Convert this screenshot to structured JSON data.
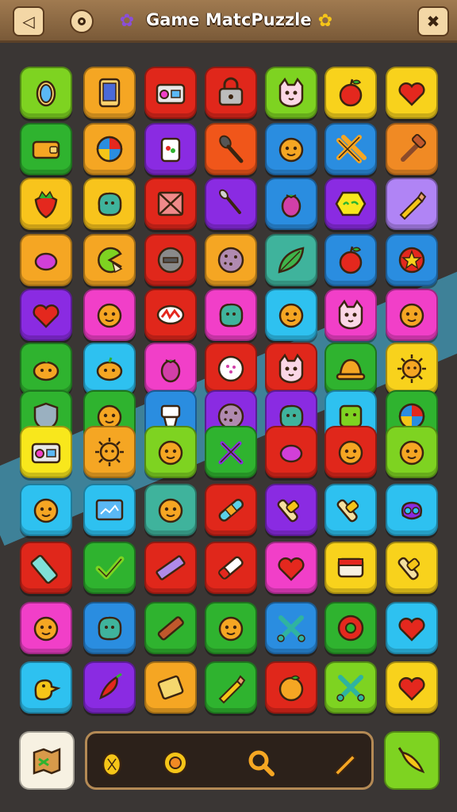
{
  "header": {
    "title": "Game MatcPuzzle",
    "back_icon": "back-arrow-icon",
    "settings_icon": "circle-icon",
    "left_deco_icon": "purple-creature-icon",
    "right_deco_icon": "yellow-creature-icon",
    "close_icon": "crossed-tools-icon",
    "bar_color": "#8b6640"
  },
  "board": {
    "background": "#3a3634",
    "stripe_color": "#3f8eaa",
    "rows": [
      [
        {
          "bg": "#7ed321",
          "icon": "mirror"
        },
        {
          "bg": "#f5a623",
          "icon": "phone"
        },
        {
          "bg": "#e0271b",
          "icon": "radio"
        },
        {
          "bg": "#e0271b",
          "icon": "lock"
        },
        {
          "bg": "#7ed321",
          "icon": "cat"
        },
        {
          "bg": "#f8d21c",
          "icon": "apple"
        },
        {
          "bg": "#f8d21c",
          "icon": "heart"
        }
      ],
      [
        {
          "bg": "#2fb32f",
          "icon": "wallet"
        },
        {
          "bg": "#f5a623",
          "icon": "ball"
        },
        {
          "bg": "#8a2be2",
          "icon": "jar"
        },
        {
          "bg": "#f0561a",
          "icon": "spatula"
        },
        {
          "bg": "#2a8de0",
          "icon": "face"
        },
        {
          "bg": "#2a8de0",
          "icon": "stripes"
        },
        {
          "bg": "#f08a24",
          "icon": "hammer"
        }
      ],
      [
        {
          "bg": "#f8c41c",
          "icon": "strawberry"
        },
        {
          "bg": "#f8c41c",
          "icon": "blob"
        },
        {
          "bg": "#e0271b",
          "icon": "crate"
        },
        {
          "bg": "#8a2be2",
          "icon": "brush"
        },
        {
          "bg": "#2a8de0",
          "icon": "plum"
        },
        {
          "bg": "#8a2be2",
          "icon": "hex"
        },
        {
          "bg": "#b084f5",
          "icon": "pencil"
        }
      ],
      [
        {
          "bg": "#f5a623",
          "icon": "egg"
        },
        {
          "bg": "#f5a623",
          "icon": "pacman"
        },
        {
          "bg": "#e0271b",
          "icon": "coin"
        },
        {
          "bg": "#f5a623",
          "icon": "cookie"
        },
        {
          "bg": "#3fb39c",
          "icon": "leaf"
        },
        {
          "bg": "#2a8de0",
          "icon": "apple"
        },
        {
          "bg": "#2a8de0",
          "icon": "star"
        }
      ],
      [
        {
          "bg": "#8a2be2",
          "icon": "heart"
        },
        {
          "bg": "#f13fc8",
          "icon": "face"
        },
        {
          "bg": "#e0271b",
          "icon": "candy"
        },
        {
          "bg": "#f13fc8",
          "icon": "blob"
        },
        {
          "bg": "#2ec1f0",
          "icon": "face"
        },
        {
          "bg": "#f13fc8",
          "icon": "cat"
        },
        {
          "bg": "#f13fc8",
          "icon": "face"
        }
      ],
      [
        {
          "bg": "#2fb32f",
          "icon": "pumpkin"
        },
        {
          "bg": "#2ec1f0",
          "icon": "pumpkin"
        },
        {
          "bg": "#f13fc8",
          "icon": "plum"
        },
        {
          "bg": "#e0271b",
          "icon": "plate"
        },
        {
          "bg": "#e0271b",
          "icon": "cat"
        },
        {
          "bg": "#2fb32f",
          "icon": "hat"
        },
        {
          "bg": "#f8d21c",
          "icon": "sun"
        }
      ],
      [
        {
          "bg": "#2fb32f",
          "icon": "shield"
        },
        {
          "bg": "#2fb32f",
          "icon": "face"
        },
        {
          "bg": "#2a8de0",
          "icon": "toilet"
        },
        {
          "bg": "#8a2be2",
          "icon": "cookie"
        },
        {
          "bg": "#8a2be2",
          "icon": "blob"
        },
        {
          "bg": "#2ec1f0",
          "icon": "cube"
        },
        {
          "bg": "#2fb32f",
          "icon": "ball"
        }
      ],
      [
        {
          "bg": "#f8e71c",
          "icon": "radio"
        },
        {
          "bg": "#f5a623",
          "icon": "sun"
        },
        {
          "bg": "#7ed321",
          "icon": "face"
        },
        {
          "bg": "#2fb32f",
          "icon": "tools"
        },
        {
          "bg": "#e0271b",
          "icon": "egg"
        },
        {
          "bg": "#e0271b",
          "icon": "face"
        },
        {
          "bg": "#7ed321",
          "icon": "face"
        }
      ],
      [
        {
          "bg": "#2ec1f0",
          "icon": "face"
        },
        {
          "bg": "#2ec1f0",
          "icon": "screen"
        },
        {
          "bg": "#3fb39c",
          "icon": "face"
        },
        {
          "bg": "#e0271b",
          "icon": "bandage"
        },
        {
          "bg": "#8a2be2",
          "icon": "roller"
        },
        {
          "bg": "#2ec1f0",
          "icon": "roller"
        },
        {
          "bg": "#2ec1f0",
          "icon": "pretzel"
        }
      ],
      [
        {
          "bg": "#e0271b",
          "icon": "tape"
        },
        {
          "bg": "#2fb32f",
          "icon": "check"
        },
        {
          "bg": "#e0271b",
          "icon": "ruler"
        },
        {
          "bg": "#e0271b",
          "icon": "eraser"
        },
        {
          "bg": "#f13fc8",
          "icon": "heart"
        },
        {
          "bg": "#f8d21c",
          "icon": "box"
        },
        {
          "bg": "#f8d21c",
          "icon": "roller"
        }
      ],
      [
        {
          "bg": "#f13fc8",
          "icon": "face"
        },
        {
          "bg": "#2a8de0",
          "icon": "blob"
        },
        {
          "bg": "#2fb32f",
          "icon": "bar"
        },
        {
          "bg": "#2fb32f",
          "icon": "face"
        },
        {
          "bg": "#2a8de0",
          "icon": "cross"
        },
        {
          "bg": "#2fb32f",
          "icon": "donut"
        },
        {
          "bg": "#2ec1f0",
          "icon": "heart"
        }
      ],
      [
        {
          "bg": "#2ec1f0",
          "icon": "duck"
        },
        {
          "bg": "#8a2be2",
          "icon": "pepper"
        },
        {
          "bg": "#f5a623",
          "icon": "scroll"
        },
        {
          "bg": "#2fb32f",
          "icon": "pencil"
        },
        {
          "bg": "#e0271b",
          "icon": "orange"
        },
        {
          "bg": "#7ed321",
          "icon": "cross"
        },
        {
          "bg": "#f8d21c",
          "icon": "heart"
        }
      ]
    ]
  },
  "tray": {
    "items": [
      "pineapple-icon",
      "sunflower-icon",
      "magnifier-icon",
      "pencil-icon"
    ],
    "border_color": "#b48a55"
  },
  "side_left": {
    "icon": "map-icon",
    "bg": "#f7f1e2"
  },
  "side_right": {
    "icon": "pepper-icon",
    "bg": "#7ed321"
  }
}
